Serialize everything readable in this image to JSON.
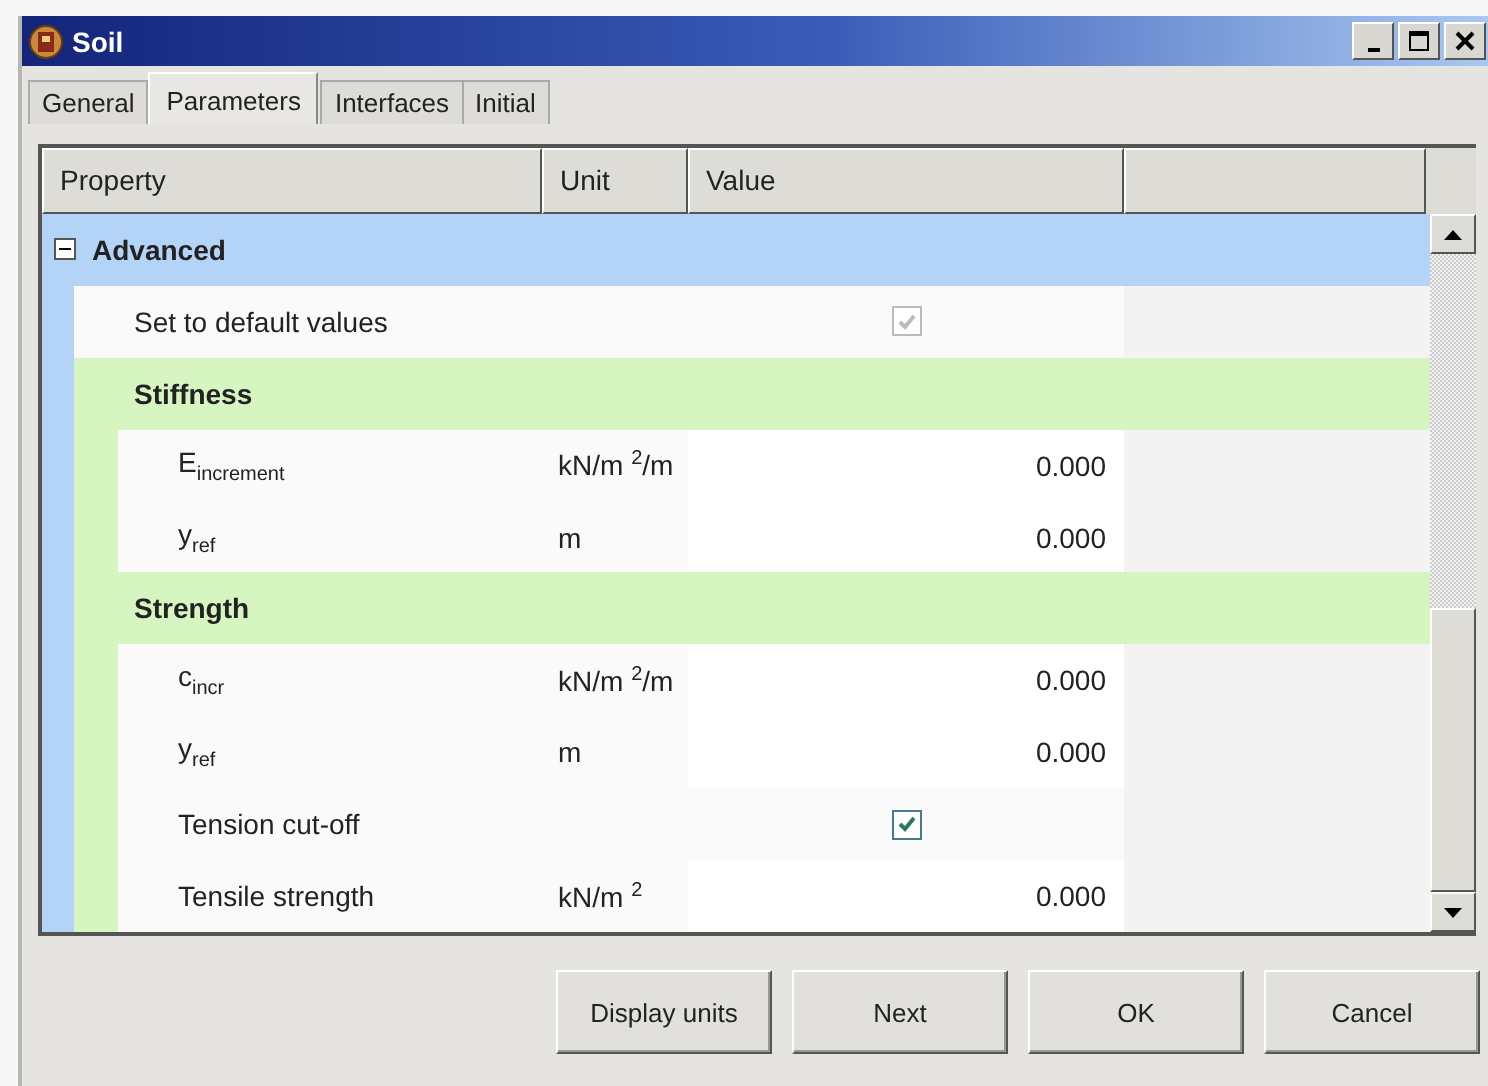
{
  "window": {
    "title": "Soil"
  },
  "tabs": [
    {
      "label": "General",
      "selected": false
    },
    {
      "label": "Parameters",
      "selected": true
    },
    {
      "label": "Interfaces",
      "selected": false
    },
    {
      "label": "Initial",
      "selected": false
    }
  ],
  "table": {
    "columns": [
      "Property",
      "Unit",
      "Value"
    ],
    "rows": [
      {
        "kind": "group",
        "label": "Advanced",
        "expanded": true,
        "children": [
          {
            "kind": "check",
            "label": "Set to default values",
            "checked": true,
            "disabled": true
          },
          {
            "kind": "group",
            "label": "Stiffness",
            "children": [
              {
                "kind": "value",
                "label": "E$_{increment}$",
                "unit": "kN/m $^{2}$/m",
                "value": "0.000"
              },
              {
                "kind": "value",
                "label": "y$_{ref}$",
                "unit": "m",
                "value": "0.000"
              }
            ]
          },
          {
            "kind": "group",
            "label": "Strength",
            "children": [
              {
                "kind": "value",
                "label": "c$_{incr}$",
                "unit": "kN/m $^{2}$/m",
                "value": "0.000"
              },
              {
                "kind": "value",
                "label": "y$_{ref}$",
                "unit": "m",
                "value": "0.000"
              },
              {
                "kind": "check",
                "label": "Tension cut-off",
                "checked": true,
                "disabled": false
              },
              {
                "kind": "value",
                "label": "Tensile strength",
                "unit": "kN/m $^{2}$",
                "value": "0.000"
              }
            ]
          }
        ]
      }
    ]
  },
  "buttons": [
    "Display units",
    "Next",
    "OK",
    "Cancel"
  ]
}
